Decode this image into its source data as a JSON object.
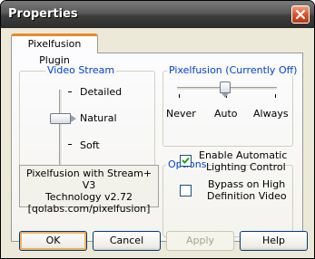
{
  "window": {
    "title": "Properties"
  },
  "tabs": [
    {
      "label": "Pixelfusion Plugin"
    }
  ],
  "video_stream": {
    "label": "Video Stream",
    "options": [
      "Detailed",
      "Natural",
      "Soft"
    ],
    "selected": "Natural"
  },
  "pixelfusion": {
    "label": "Pixelfusion (Currently Off)",
    "options": [
      "Never",
      "Auto",
      "Always"
    ],
    "selected": "Auto"
  },
  "options": {
    "label": "Options",
    "enable_lighting": {
      "line1": "Enable Automatic",
      "line2": "Lighting Control",
      "checked": true
    },
    "bypass_hd": {
      "line1": "Bypass on High",
      "line2": "Definition Video",
      "checked": false
    }
  },
  "info": {
    "line1": "Pixelfusion with Stream+ V3",
    "line2": "Technology v2.72",
    "line3": "[qolabs.com/pixelfusion]"
  },
  "buttons": {
    "ok": "OK",
    "cancel": "Cancel",
    "apply": "Apply",
    "help": "Help"
  },
  "colors": {
    "accent_tab": "#e68b2c",
    "group_label": "#0046d5",
    "close_button": "#d8552c"
  }
}
